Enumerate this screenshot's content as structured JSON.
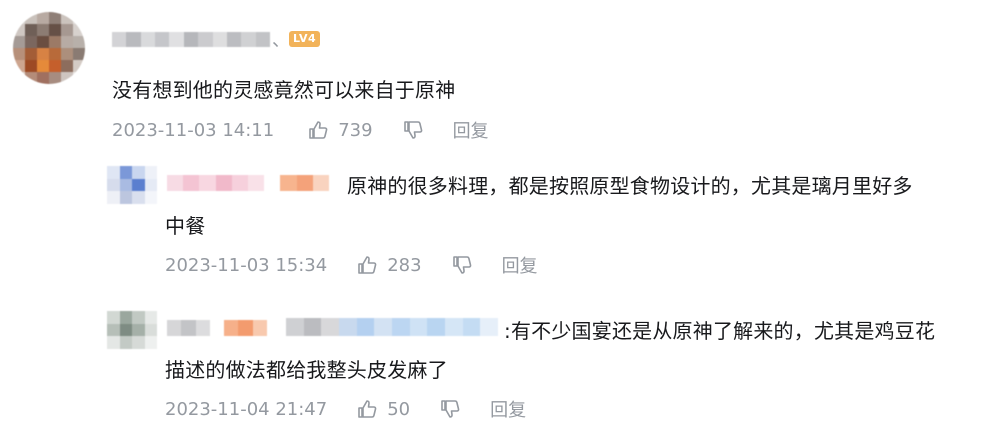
{
  "colors": {
    "text": "#18191c",
    "meta": "#9499a0",
    "badge": "#f2b35a",
    "background": "#ffffff"
  },
  "comments": [
    {
      "badge": "LV4",
      "separator": "、",
      "text": "没有想到他的灵感竟然可以来自于原神",
      "date": "2023-11-03 14:11",
      "likes": "739",
      "reply_label": "回复",
      "like_icon": "thumbs-up-icon",
      "dislike_icon": "thumbs-down-icon"
    }
  ],
  "replies": [
    {
      "text_line1": "原神的很多料理，都是按照原型食物设计的，尤其是璃月里好多",
      "text_line2": "中餐",
      "date": "2023-11-03 15:34",
      "likes": "283",
      "reply_label": "回复"
    },
    {
      "text_line1": ":有不少国宴还是从原神了解来的，尤其是鸡豆花",
      "text_line2": "描述的做法都给我整头皮发麻了",
      "date": "2023-11-04 21:47",
      "likes": "50",
      "reply_label": "回复"
    }
  ]
}
